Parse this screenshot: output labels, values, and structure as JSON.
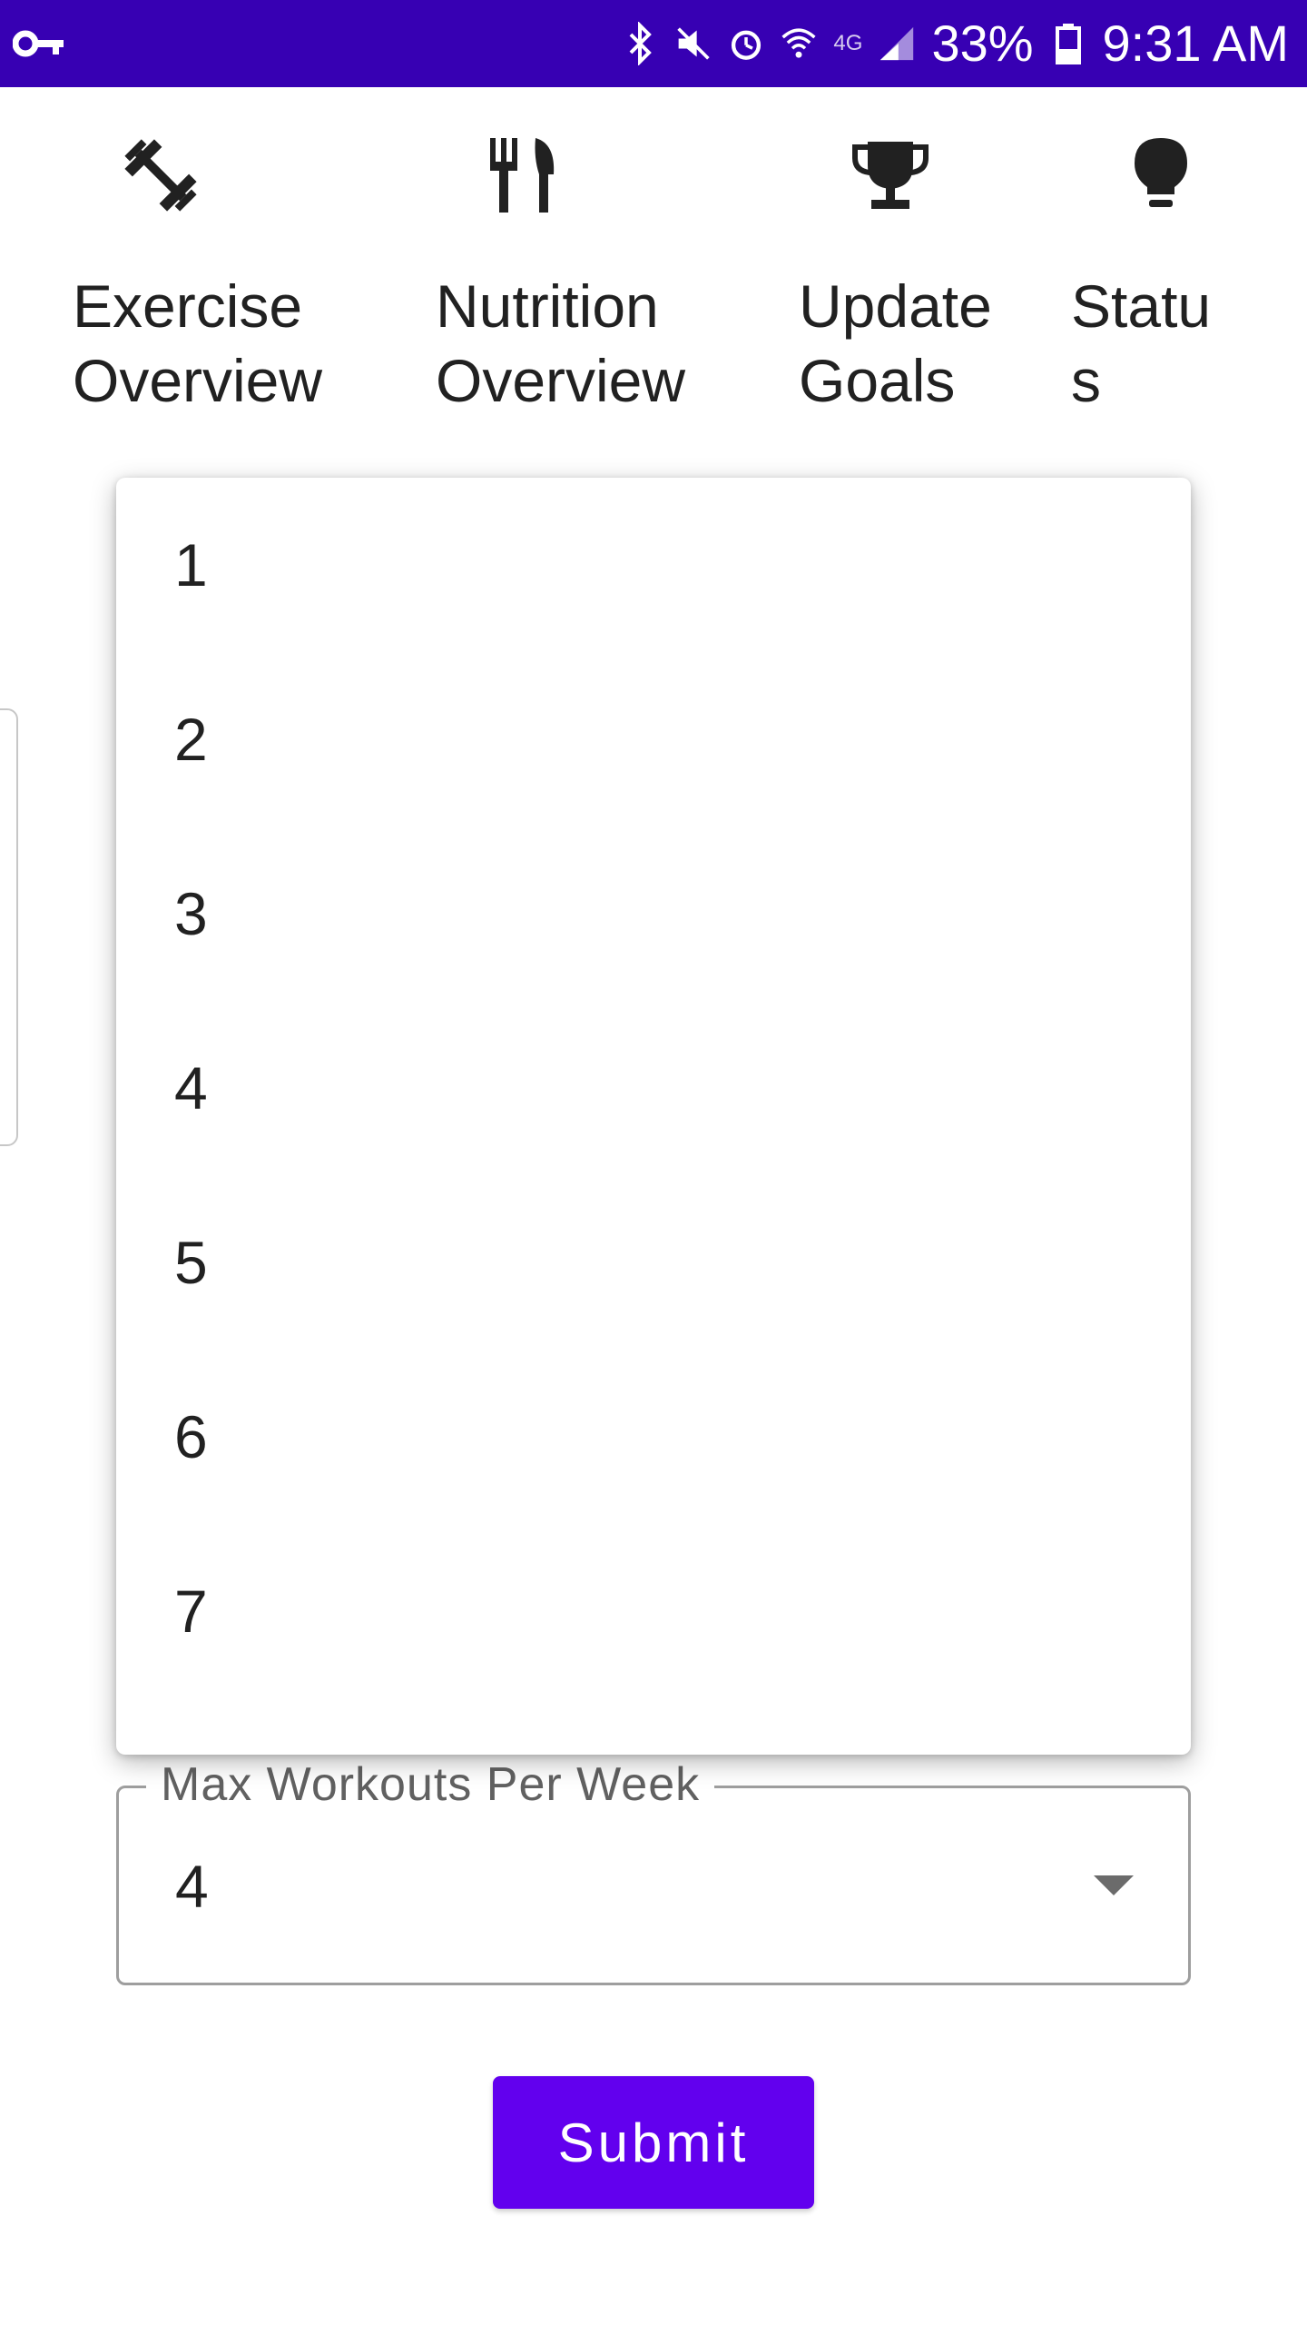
{
  "status_bar": {
    "battery": "33%",
    "time": "9:31 AM",
    "network": "4G",
    "icons": [
      "vpn-key-icon",
      "bluetooth-icon",
      "mute-icon",
      "alarm-icon",
      "wifi-icon",
      "signal-icon",
      "battery-icon"
    ]
  },
  "nav": {
    "items": [
      {
        "label": "Exercise\nOverview",
        "icon": "dumbbell-icon"
      },
      {
        "label": "Nutrition\nOverview",
        "icon": "fork-knife-icon"
      },
      {
        "label": "Update\nGoals",
        "icon": "trophy-icon"
      },
      {
        "label": "Statu\ns",
        "icon": "lightbulb-icon"
      }
    ]
  },
  "dropdown": {
    "options": [
      "1",
      "2",
      "3",
      "4",
      "5",
      "6",
      "7"
    ]
  },
  "max_workouts_field": {
    "label": "Max Workouts Per Week",
    "value": "4"
  },
  "submit_label": "Submit",
  "colors": {
    "status_bar": "#3700b3",
    "primary": "#6200ee"
  }
}
